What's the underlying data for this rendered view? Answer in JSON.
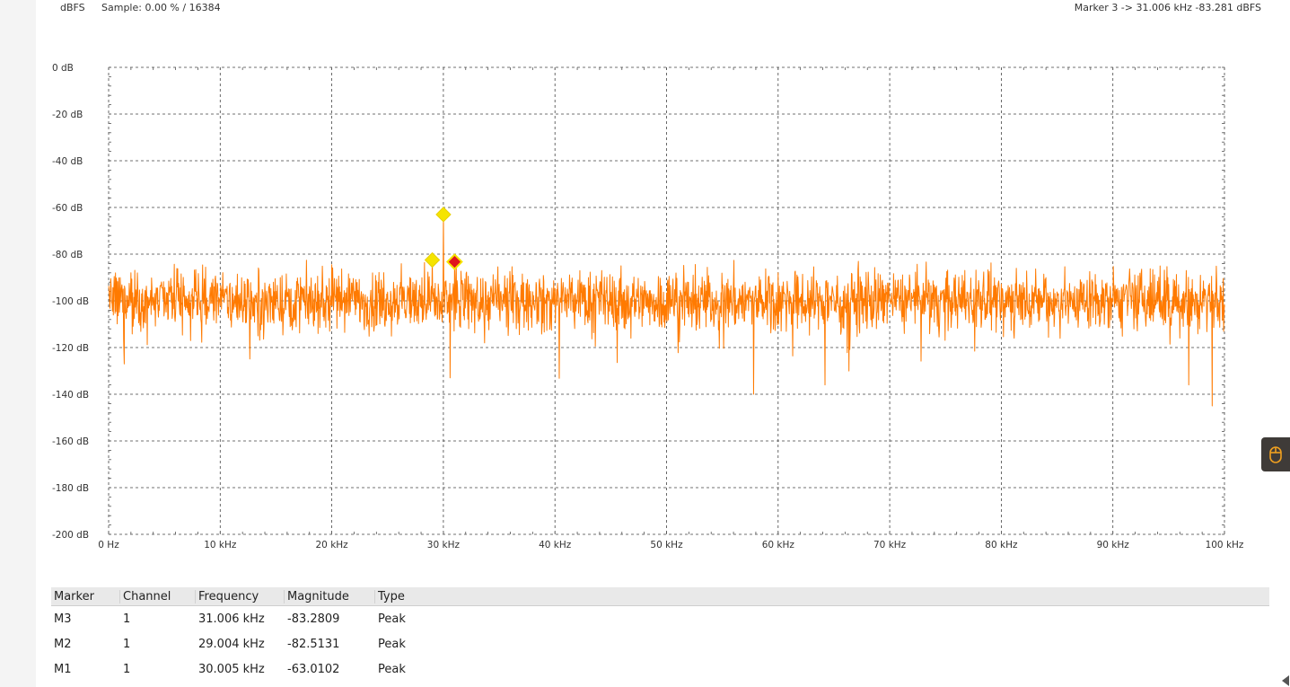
{
  "header": {
    "unit": "dBFS",
    "sample": "Sample: 0.00 % / 16384",
    "marker_readout": "Marker 3 -> 31.006 kHz -83.281 dBFS"
  },
  "chart_data": {
    "type": "line",
    "x_unit": "kHz",
    "xlim": [
      0,
      100
    ],
    "ylim": [
      -200,
      0
    ],
    "x_ticks": [
      "0 Hz",
      "10 kHz",
      "20 kHz",
      "30 kHz",
      "40 kHz",
      "50 kHz",
      "60 kHz",
      "70 kHz",
      "80 kHz",
      "90 kHz",
      "100 kHz"
    ],
    "y_ticks": [
      "0 dB",
      "-20 dB",
      "-40 dB",
      "-60 dB",
      "-80 dB",
      "-100 dB",
      "-120 dB",
      "-140 dB",
      "-160 dB",
      "-180 dB",
      "-200 dB"
    ],
    "grid": true,
    "series_color": "#ff7a00",
    "noise_floor_db": -100,
    "noise_spread_db": 7,
    "peaks": [
      {
        "x": 30.005,
        "y": -63.0102
      },
      {
        "x": 29.004,
        "y": -82.5131
      },
      {
        "x": 31.006,
        "y": -83.2809
      },
      {
        "x": 27.0,
        "y": -90
      },
      {
        "x": 60.0,
        "y": -88
      },
      {
        "x": 2.0,
        "y": -88
      }
    ],
    "dips": [
      {
        "x": 57.8,
        "y": -140
      },
      {
        "x": 98.9,
        "y": -145
      },
      {
        "x": 30.6,
        "y": -133
      },
      {
        "x": 64.2,
        "y": -136
      },
      {
        "x": 96.8,
        "y": -136
      },
      {
        "x": 1.4,
        "y": -127
      }
    ],
    "markers": [
      {
        "x": 30.005,
        "y": -63.0102,
        "color": "#f5e400"
      },
      {
        "x": 29.004,
        "y": -82.5131,
        "color": "#f5e400"
      },
      {
        "x": 31.006,
        "y": -83.2809,
        "color": "#e0141e",
        "selected": true
      }
    ]
  },
  "marker_table": {
    "columns": [
      "Marker",
      "Channel",
      "Frequency",
      "Magnitude",
      "Type"
    ],
    "rows": [
      [
        "M3",
        "1",
        "31.006 kHz",
        "-83.2809",
        "Peak"
      ],
      [
        "M2",
        "1",
        "29.004 kHz",
        "-82.5131",
        "Peak"
      ],
      [
        "M1",
        "1",
        "30.005 kHz",
        "-63.0102",
        "Peak"
      ]
    ]
  },
  "side_button": {
    "icon": "mouse-icon",
    "color": "#f0a020"
  }
}
